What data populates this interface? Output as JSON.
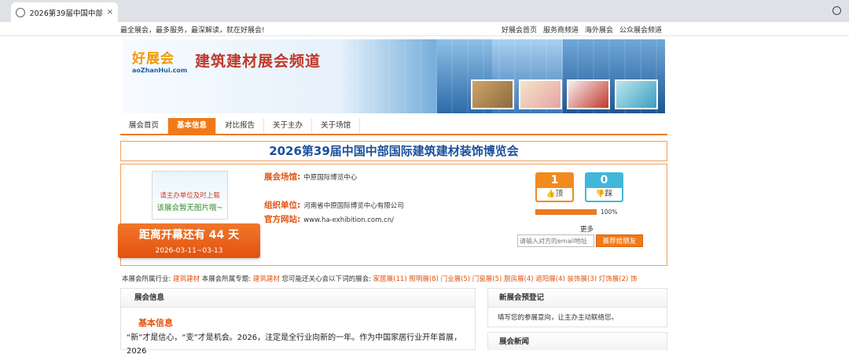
{
  "browser": {
    "tab_title": "2026第39届中国中部...",
    "close_glyph": "×"
  },
  "topbar": {
    "slogan": "最全展会，最多服务，最深解读，就在好展会!",
    "links": [
      "好展会首页",
      "服务商频道",
      "海外展会",
      "公众展会频道"
    ]
  },
  "banner": {
    "logo_cn": "好展会",
    "logo_en": "aoZhanHui.com",
    "channel_title": "建筑建材展会频道"
  },
  "nav": {
    "items": [
      "展会首页",
      "基本信息",
      "对比报告",
      "关于主办",
      "关于场馆"
    ],
    "active": "基本信息"
  },
  "expo": {
    "title": "2026第39届中国中部国际建筑建材装饰博览会",
    "image_placeholder": {
      "line1": "请主办单位及时上载",
      "line2": "该展会暂无图片哦~"
    },
    "countdown": {
      "text": "距离开幕还有 44 天",
      "dates": "2026-03-11~03-13"
    },
    "venue_label": "展会场馆:",
    "venue_value": "中原国际博览中心",
    "organizer_label": "组织单位:",
    "organizer_value": "河南省中原国际博览中心有限公司",
    "website_label": "官方网站:",
    "website_value": "www.ha-exhibition.com.cn/",
    "votes": {
      "up_count": "1",
      "up_label": "顶",
      "down_count": "0",
      "down_label": "踩",
      "percent": "100%",
      "percent_value": 100
    },
    "more_label": "更多",
    "email_placeholder": "请输入对方的email地址",
    "recommend_button": "推荐给朋友"
  },
  "industry": {
    "prefix": "本展会所属行业:",
    "industry": "建筑建材",
    "topic_prefix": "本展会所属专题:",
    "topic": "建筑建材",
    "related_prefix": "您可能还关心会以下词的展会:",
    "related": "家居展(11)  照明展(8)  门业展(5)  门窗展(5)  厨房展(4)  遮阳展(4)  装饰展(3)  灯饰展(2)  饰"
  },
  "left_panel": {
    "header": "展会信息",
    "subheader": "基本信息",
    "text": "“新”才是信心，“变”才是机会。2026，注定是全行业向新的一年。作为中国家居行业开年首展，2026"
  },
  "right_panel": {
    "header": "新展会预登记",
    "text": "填写您的参展意向，让主办主动联络您。"
  },
  "news_panel": {
    "header": "展会新闻"
  },
  "colors": {
    "accent": "#f07a18",
    "title_blue": "#1a4f9c",
    "label_orange": "#e2520e"
  }
}
